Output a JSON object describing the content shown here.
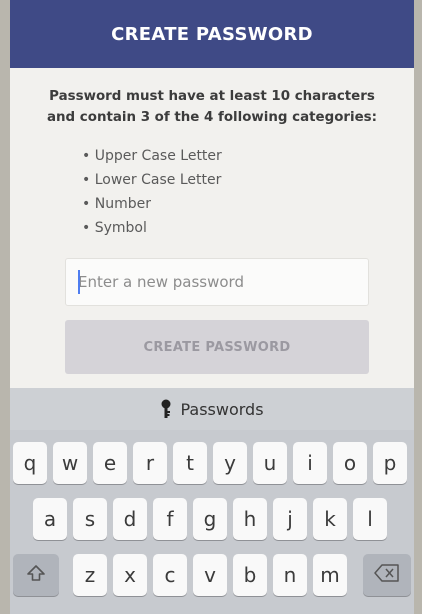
{
  "header": {
    "title": "CREATE PASSWORD"
  },
  "requirements": {
    "text_line1": "Password must have at least 10 characters",
    "text_line2": "and contain 3 of the 4 following categories:",
    "categories": [
      "Upper Case Letter",
      "Lower Case Letter",
      "Number",
      "Symbol"
    ]
  },
  "password_field": {
    "value": "",
    "placeholder": "Enter a new password"
  },
  "create_button": {
    "label": "CREATE PASSWORD"
  },
  "keyboard": {
    "suggestion": "Passwords",
    "row1": [
      "q",
      "w",
      "e",
      "r",
      "t",
      "y",
      "u",
      "i",
      "o",
      "p"
    ],
    "row2": [
      "a",
      "s",
      "d",
      "f",
      "g",
      "h",
      "j",
      "k",
      "l"
    ],
    "row3": [
      "z",
      "x",
      "c",
      "v",
      "b",
      "n",
      "m"
    ]
  },
  "colors": {
    "header_bg": "#3f4a86",
    "caret": "#4f7df0",
    "button_bg": "#d5d3d8"
  }
}
